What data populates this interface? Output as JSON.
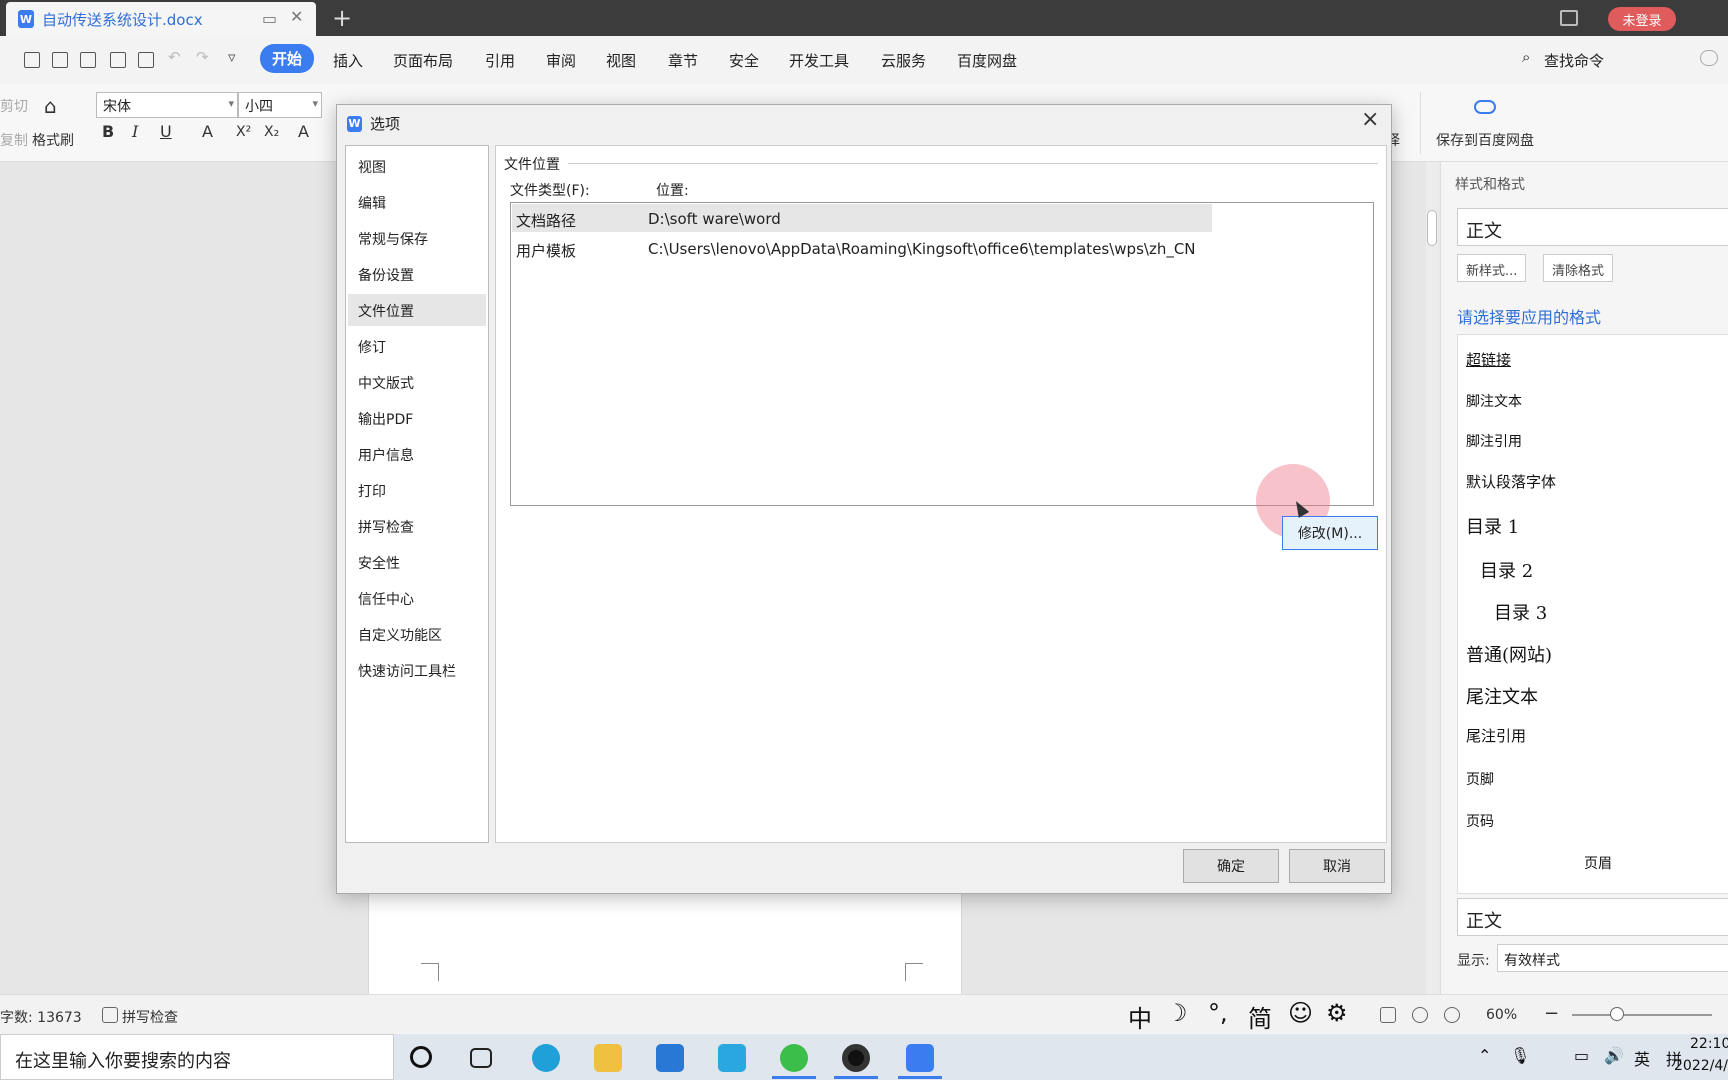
{
  "titlebar": {
    "doc_title": "自动传送系统设计.docx",
    "new_tab": "+",
    "login": "未登录",
    "window_icon": "W"
  },
  "menu": {
    "items": [
      "开始",
      "插入",
      "页面布局",
      "引用",
      "审阅",
      "视图",
      "章节",
      "安全",
      "开发工具",
      "云服务",
      "百度网盘"
    ],
    "active": "开始",
    "find": "查找命令"
  },
  "ribbon": {
    "cut": "剪切",
    "copy": "复制",
    "format_painter": "格式刷",
    "font": "宋体",
    "font_size": "小四",
    "bold": "B",
    "italic": "I",
    "underline": "U",
    "font_color": "A",
    "superscript": "X²",
    "subscript": "X₂",
    "text_effect": "A",
    "save_baidu": "保存到百度网盘",
    "select_tail": "择"
  },
  "right_panel": {
    "title": "样式和格式",
    "current_style": "正文",
    "new_style": "新样式...",
    "clear_format": "清除格式",
    "hint": "请选择要应用的格式",
    "styles": [
      "超链接",
      "脚注文本",
      "脚注引用",
      "默认段落字体",
      "目录 1",
      "目录 2",
      "目录 3",
      "普通(网站)",
      "尾注文本",
      "尾注引用",
      "页脚",
      "页码",
      "页眉",
      "正文"
    ],
    "show_label": "显示:",
    "show_value": "有效样式"
  },
  "dialog": {
    "title": "选项",
    "close": "×",
    "nav": [
      "视图",
      "编辑",
      "常规与保存",
      "备份设置",
      "文件位置",
      "修订",
      "中文版式",
      "输出PDF",
      "用户信息",
      "打印",
      "拼写检查",
      "安全性",
      "信任中心",
      "自定义功能区",
      "快速访问工具栏"
    ],
    "selected_nav": "文件位置",
    "group_title": "文件位置",
    "col_type": "文件类型(F):",
    "col_location": "位置:",
    "rows": [
      {
        "type": "文档路径",
        "location": "D:\\soft ware\\word"
      },
      {
        "type": "用户模板",
        "location": "C:\\Users\\lenovo\\AppData\\Roaming\\Kingsoft\\office6\\templates\\wps\\zh_CN"
      }
    ],
    "modify": "修改(M)...",
    "ok": "确定",
    "cancel": "取消"
  },
  "statusbar": {
    "word_count": "字数: 13673",
    "spell_check": "拼写检查",
    "ime": [
      "中",
      "☽",
      "°,",
      "简",
      "☺",
      "⚙"
    ],
    "zoom": "60%"
  },
  "taskbar": {
    "search_placeholder": "在这里输入你要搜索的内容",
    "tray_lang": "英",
    "tray_ime": "拼",
    "time": "22:10",
    "date": "2022/4/"
  },
  "colors": {
    "accent": "#3b7cf0",
    "login_red": "#e05b5b",
    "link_blue": "#2f6fd6"
  }
}
